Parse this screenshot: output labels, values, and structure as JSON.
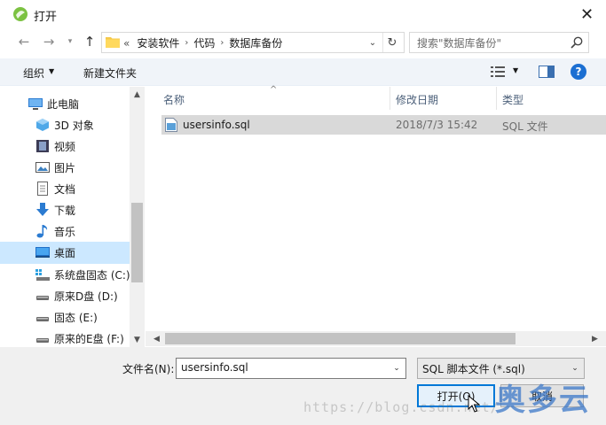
{
  "window": {
    "title": "打开"
  },
  "address": {
    "breadcrumbs": [
      "«",
      "安装软件",
      "代码",
      "数据库备份"
    ]
  },
  "search": {
    "placeholder": "搜索\"数据库备份\""
  },
  "toolbar": {
    "organize_label": "组织",
    "new_folder_label": "新建文件夹",
    "help_label": "?"
  },
  "nav": {
    "items": [
      {
        "label": "此电脑",
        "icon": "computer-icon"
      },
      {
        "label": "3D 对象",
        "icon": "3d-objects-icon"
      },
      {
        "label": "视频",
        "icon": "video-icon"
      },
      {
        "label": "图片",
        "icon": "picture-icon"
      },
      {
        "label": "文档",
        "icon": "document-icon"
      },
      {
        "label": "下载",
        "icon": "download-icon"
      },
      {
        "label": "音乐",
        "icon": "music-icon"
      },
      {
        "label": "桌面",
        "icon": "desktop-icon",
        "selected": true
      },
      {
        "label": "系统盘固态 (C:)",
        "icon": "system-drive-icon"
      },
      {
        "label": "原来D盘 (D:)",
        "icon": "drive-icon"
      },
      {
        "label": "固态 (E:)",
        "icon": "drive-icon"
      },
      {
        "label": "原来的E盘 (F:)",
        "icon": "drive-icon"
      }
    ]
  },
  "filelist": {
    "columns": [
      "名称",
      "修改日期",
      "类型"
    ],
    "rows": [
      {
        "name": "usersinfo.sql",
        "modified": "2018/7/3 15:42",
        "type": "SQL 文件"
      }
    ]
  },
  "bottom": {
    "filename_label": "文件名(N):",
    "filename_value": "usersinfo.sql",
    "filetype_value": "SQL 脚本文件 (*.sql)",
    "open_label": "打开(O)",
    "cancel_label": "取消"
  },
  "watermark": {
    "url": "https://blog.csdn.net/",
    "brand": "奥多云"
  },
  "colors": {
    "accent": "#0078d7",
    "selection": "#cce8ff",
    "row_selected": "#d9d9d9"
  }
}
